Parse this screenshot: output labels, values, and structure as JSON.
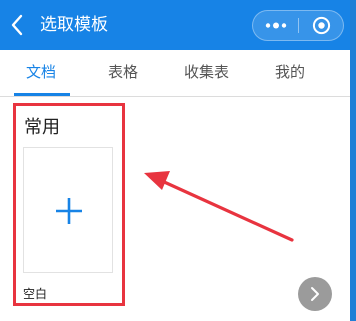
{
  "header": {
    "title": "选取模板",
    "back_icon": "chevron-left-icon",
    "more_icon": "more-dots-icon",
    "close_icon": "target-icon",
    "color": "#1783e6"
  },
  "tabs": [
    {
      "label": "文档",
      "active": true
    },
    {
      "label": "表格",
      "active": false
    },
    {
      "label": "收集表",
      "active": false
    },
    {
      "label": "我的",
      "active": false
    }
  ],
  "section": {
    "title": "常用",
    "templates": [
      {
        "label": "空白",
        "icon": "plus-icon"
      }
    ]
  },
  "annotation": {
    "color": "#e8343f"
  },
  "fab": {
    "icon": "chevron-right-icon"
  }
}
